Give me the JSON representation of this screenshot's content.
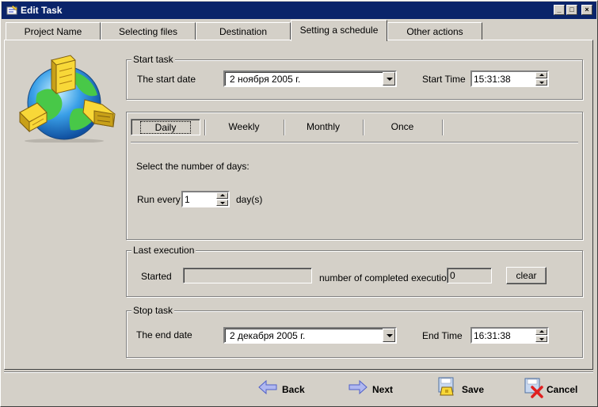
{
  "window": {
    "title": "Edit Task"
  },
  "title_buttons": {
    "minimize": "_",
    "maximize": "□",
    "close": "×"
  },
  "tabs": [
    {
      "label": "Project Name"
    },
    {
      "label": "Selecting files"
    },
    {
      "label": "Destination"
    },
    {
      "label": "Setting a schedule",
      "active": true
    },
    {
      "label": "Other actions"
    }
  ],
  "start_task": {
    "legend": "Start task",
    "date_label": "The start date",
    "date_value": "2  ноября  2005 г.",
    "time_label": "Start Time",
    "time_value": "15:31:38"
  },
  "schedule": {
    "tabs": [
      "Daily",
      "Weekly",
      "Monthly",
      "Once"
    ],
    "active": "Daily",
    "prompt": "Select the number of days:",
    "run_every_label": "Run every",
    "run_every_value": "1",
    "unit_label": "day(s)"
  },
  "last_execution": {
    "legend": "Last execution",
    "started_label": "Started",
    "started_value": "",
    "count_label": "number of completed executions",
    "count_value": "0",
    "clear_label": "clear"
  },
  "stop_task": {
    "legend": "Stop task",
    "date_label": "The end date",
    "date_value": "2 декабря  2005 г.",
    "time_label": "End Time",
    "time_value": "16:31:38"
  },
  "footer": {
    "back_label": "Back",
    "next_label": "Next",
    "save_label": "Save",
    "cancel_label": "Cancel"
  },
  "colors": {
    "titlebar": "#0a246a",
    "face": "#d4d0c8",
    "arrow": "#6a78d8"
  }
}
